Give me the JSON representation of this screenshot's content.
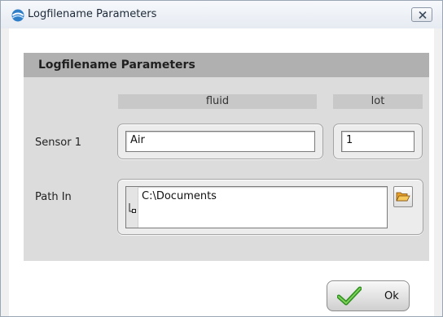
{
  "window": {
    "title": "Logfilename Parameters",
    "app_icon": "app-logo-icon",
    "close_icon": "close-icon"
  },
  "panel": {
    "title": "Logfilename Parameters",
    "columns": [
      "fluid",
      "lot"
    ]
  },
  "sensor_row": {
    "label": "Sensor 1",
    "fluid_value": "Air",
    "lot_value": "1"
  },
  "path_row": {
    "label": "Path In",
    "value": "C:\\Documents",
    "browse_icon": "folder-open-icon"
  },
  "footer": {
    "ok_label": "Ok",
    "ok_icon": "checkmark-icon"
  }
}
